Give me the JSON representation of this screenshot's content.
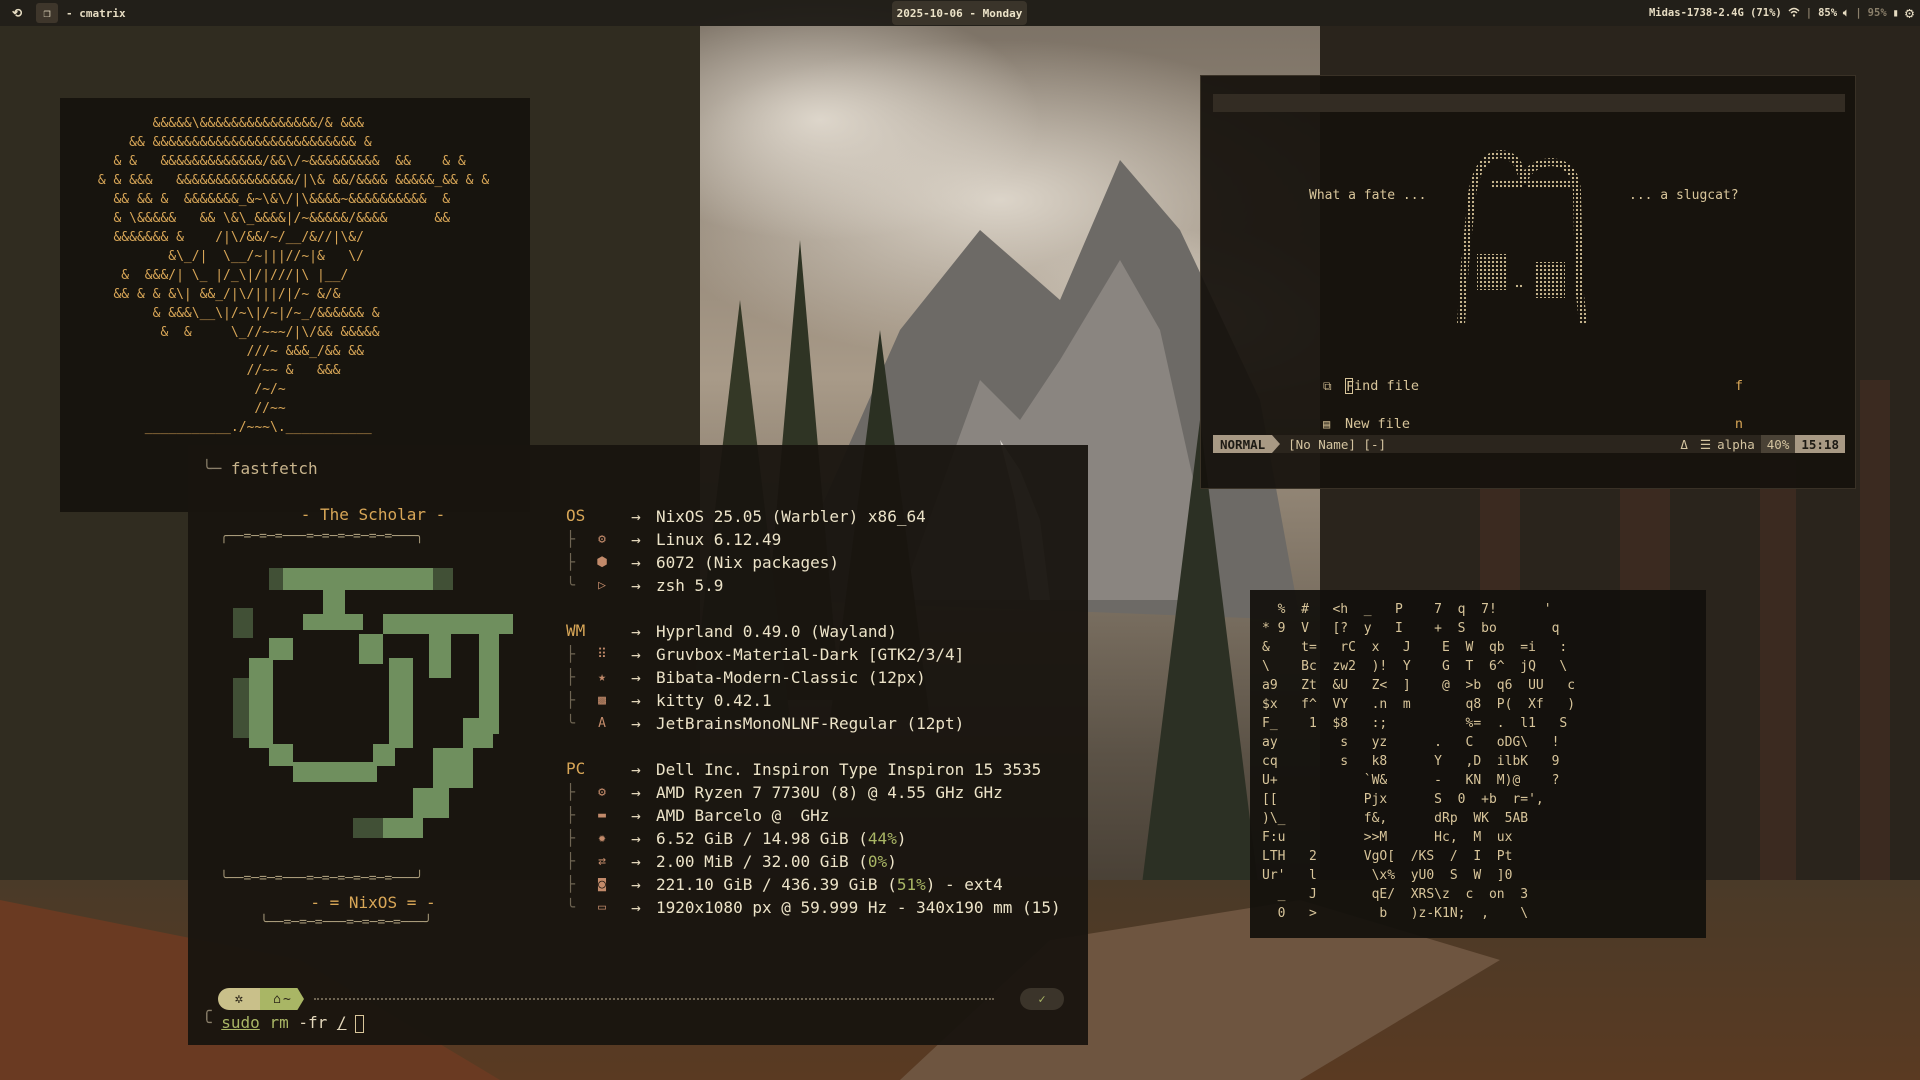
{
  "topbar": {
    "workspace_1_icon": "refresh-icon",
    "workspace_2_icon": "terminal-icon",
    "window_title": "- cmatrix",
    "date": "2025-10-06 - Monday",
    "network": "Midas-1738-2.4G (71%)",
    "separator": "|",
    "volume": "85%",
    "battery": "95%",
    "settings_icon": "gear-icon"
  },
  "tree_ascii": "        &&&&&\\&&&&&&&&&&&&&&&/& &&&\n     && &&&&&&&&&&&&&&&&&&&&&&&&&& &\n   & &   &&&&&&&&&&&&&/&&\\/~&&&&&&&&&  &&    & &\n & & &&&   &&&&&&&&&&&&&&&/|\\& &&/&&&& &&&&&_&& & &\n   && && &  &&&&&&&_&~\\&\\/|\\&&&&~&&&&&&&&&&  &\n   & \\&&&&&   && \\&\\_&&&&|/~&&&&&/&&&&      &&\n   &&&&&&& &    /|\\/&&/~/__/&//|\\&/\n          &\\_/|  \\__/~|||//~|&   \\/\n    &  &&&/| \\_ |/_\\|/|///|\\ |__/\n   && & & &\\| &&_/|\\/|||/|/~ &/&\n        & &&&\\__\\|/~\\|/~|/~_/&&&&&& &\n         &  &     \\_//~~~/|\\/&& &&&&&\n                    ///~ &&&_/&& &&\n                    //~~ &   &&&\n                     /~/~\n                     //~~\n       ___________./~~~\\.___________",
  "nvim": {
    "quote_left": "What a fate ...",
    "quote_right": "... a slugcat?",
    "menu": [
      {
        "icon": "copy-icon",
        "label": "ind file",
        "label_first": "F",
        "key": "f"
      },
      {
        "icon": "file-icon",
        "label": "New file",
        "key": "n"
      }
    ],
    "status": {
      "mode": "NORMAL",
      "file": "[No Name] [-]",
      "extra": "Δ",
      "filetype": "alpha",
      "percent": "40%",
      "time": "15:18"
    }
  },
  "fastfetch": {
    "header": "fastfetch",
    "title": "- The Scholar -",
    "footer": "- = NixOS = -",
    "rule_top": "╭──=─=─=───=─=─=─=─=─=───╮",
    "rule_bottom": "╰──=─=─=───=─=─=─=─=─=───╯",
    "rule_bottom2": "╰──=─=─=───=─=─=─=───╯",
    "groups": [
      {
        "key": "OS",
        "rows": [
          {
            "icon": "",
            "value": "NixOS 25.05 (Warbler) x86_64"
          },
          {
            "icon": "gear-icon",
            "value": "Linux 6.12.49"
          },
          {
            "icon": "package-icon",
            "value": "6072 (Nix packages)"
          },
          {
            "icon": "terminal-icon",
            "value": "zsh 5.9"
          }
        ]
      },
      {
        "key": "WM",
        "rows": [
          {
            "icon": "",
            "value": "Hyprland 0.49.0 (Wayland)"
          },
          {
            "icon": "grid-icon",
            "value": "Gruvbox-Material-Dark [GTK2/3/4]"
          },
          {
            "icon": "star-icon",
            "value": "Bibata-Modern-Classic (12px)"
          },
          {
            "icon": "kitty-icon",
            "value": "kitty 0.42.1"
          },
          {
            "icon": "font-icon",
            "value": "JetBrainsMonoNLNF-Regular (12pt)"
          }
        ]
      },
      {
        "key": "PC",
        "rows": [
          {
            "icon": "",
            "value": "Dell Inc. Inspiron Type Inspiron 15 3535"
          },
          {
            "icon": "cpu-icon",
            "value": "AMD Ryzen 7 7730U (8) @ 4.55 GHz GHz"
          },
          {
            "icon": "gpu-icon",
            "value": "AMD Barcelo @  GHz"
          },
          {
            "icon": "memory-icon",
            "value_pre": "6.52 GiB / 14.98 GiB (",
            "value_hi": "44%",
            "value_post": ")"
          },
          {
            "icon": "swap-icon",
            "value_pre": "2.00 MiB / 32.00 GiB (",
            "value_hi": "0%",
            "value_post": ")"
          },
          {
            "icon": "disk-icon",
            "value_pre": "221.10 GiB / 436.39 GiB (",
            "value_hi": "51%",
            "value_post": ") - ext4"
          },
          {
            "icon": "monitor-icon",
            "value": "1920x1080 px @ 59.999 Hz - 340x190 mm (15)"
          }
        ]
      }
    ],
    "arrow": "→",
    "prompt": {
      "home": "~",
      "check": "✓",
      "cmd_sudo": "sudo",
      "cmd_rm": "rm",
      "cmd_flag": "-fr",
      "cmd_path": "/"
    }
  },
  "matrix_text": "  %  #   <h  _   P    7  q  7!      '\n* 9  V   [?  y   I    +  S  bo       q\n&    t=   rC  x   J    E  W  qb  =i   :\n\\    Bc  zw2  )!  Y    G  T  6^  jQ   \\\na9   Zt  &U   Z<  ]    @  >b  q6  UU   c\n$x   f^  VY   .n  m       q8  P(  Xf   )\nF_    1  $8   :;          %=  .  l1   S\nay        s   yz      .   C   oDG\\   !\ncq        s   k8      Y   ,D  ilbK   9\nU+           `W&      -   KN  M)@    ?\n[[           Pjx      S  0  +b  r=', \n)\\_          f&,      dRp  WK  5AB\nF:u          >>M      Hc,  M  ux\nLTH   2      VgO[  /KS  /  I  Pt\nUr'   l       \\x%  yU0  S  W  ]0\n  _   J       qE/  XRS\\z  c  on  3\n  0   >        b   )z-K1N;  ,    \\"
}
